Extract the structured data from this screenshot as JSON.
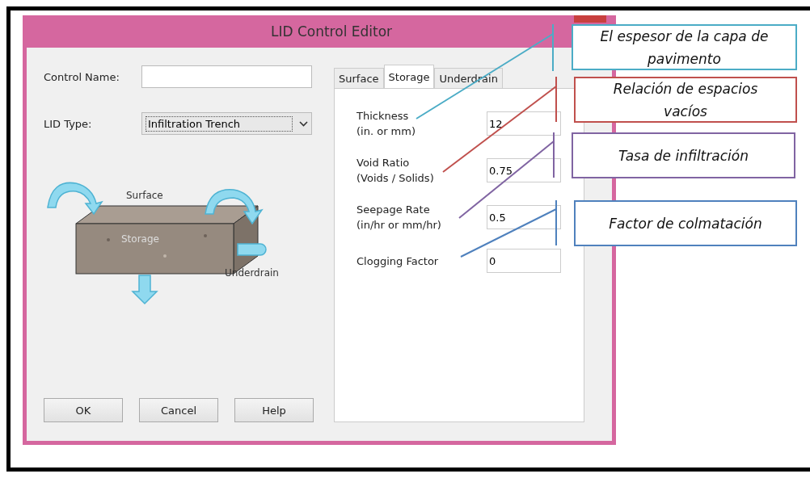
{
  "window": {
    "title": "LID Control Editor"
  },
  "control_name": {
    "label": "Control Name:"
  },
  "lid_type": {
    "label": "LID Type:",
    "value": "Infiltration Trench"
  },
  "diagram": {
    "surface": "Surface",
    "storage": "Storage",
    "underdrain": "Underdrain"
  },
  "buttons": [
    "OK",
    "Cancel",
    "Help"
  ],
  "tabs": [
    {
      "label": "Surface",
      "selected": false
    },
    {
      "label": "Storage",
      "selected": true
    },
    {
      "label": "Underdrain",
      "selected": false
    }
  ],
  "parameters": [
    {
      "name": "Thickness",
      "unit": "(in. or mm)",
      "value": "12"
    },
    {
      "name": "Void Ratio",
      "unit": "(Voids / Solids)",
      "value": "0.75"
    },
    {
      "name": "Seepage Rate",
      "unit": "(in/hr or mm/hr)",
      "value": "0.5"
    },
    {
      "name": "Clogging Factor",
      "value": "0"
    }
  ],
  "callouts": [
    {
      "text": "El espesor de la capa de pavimento",
      "color": "#4bacc6"
    },
    {
      "text": "Relación de espacios vacíos",
      "color": "#c0504d"
    },
    {
      "text": "Tasa de infiltración",
      "color": "#8064a2"
    },
    {
      "text": "Factor de colmatación",
      "color": "#4f81bd"
    }
  ]
}
